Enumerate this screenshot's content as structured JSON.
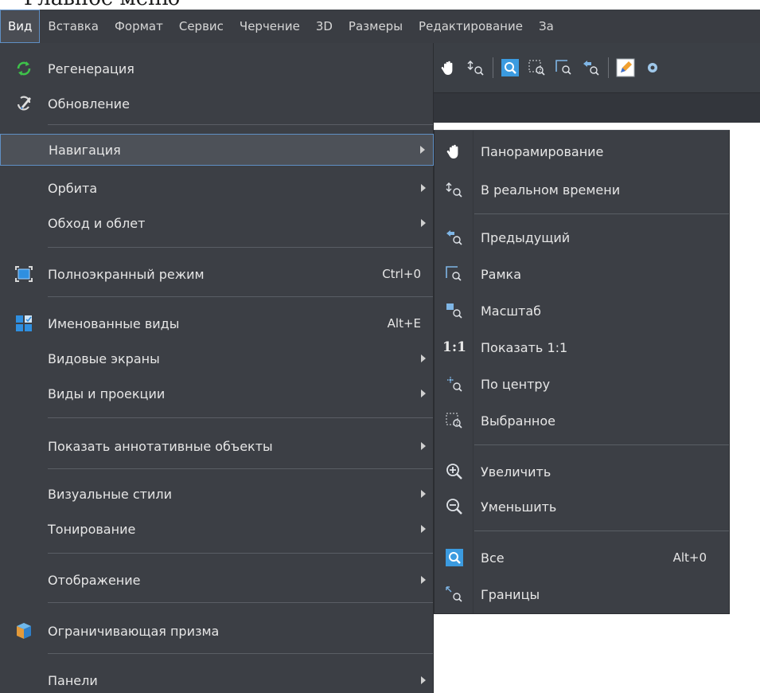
{
  "top_text": "Главное меню",
  "menubar": {
    "items": [
      {
        "label": "Вид",
        "active": true
      },
      {
        "label": "Вставка"
      },
      {
        "label": "Формат"
      },
      {
        "label": "Сервис"
      },
      {
        "label": "Черчение"
      },
      {
        "label": "3D"
      },
      {
        "label": "Размеры"
      },
      {
        "label": "Редактирование"
      },
      {
        "label": "За"
      }
    ]
  },
  "view_menu": {
    "items": [
      {
        "label": "Регенерация",
        "icon": "regen-icon"
      },
      {
        "label": "Обновление",
        "icon": "update-icon"
      },
      {
        "label": "Навигация",
        "submenu": true,
        "highlighted": true
      },
      {
        "label": "Орбита",
        "submenu": true
      },
      {
        "label": "Обход и облет",
        "submenu": true
      },
      {
        "label": "Полноэкранный режим",
        "shortcut": "Ctrl+0",
        "icon": "fullscreen-icon"
      },
      {
        "label": "Именованные виды",
        "shortcut": "Alt+E",
        "icon": "named-views-icon"
      },
      {
        "label": "Видовые экраны",
        "submenu": true
      },
      {
        "label": "Виды и проекции",
        "submenu": true
      },
      {
        "label": "Показать аннотативные объекты",
        "submenu": true
      },
      {
        "label": "Визуальные стили",
        "submenu": true
      },
      {
        "label": "Тонирование",
        "submenu": true
      },
      {
        "label": "Отображение",
        "submenu": true
      },
      {
        "label": "Ограничивающая призма",
        "icon": "bounding-prism-icon"
      },
      {
        "label": "Панели",
        "submenu": true
      }
    ]
  },
  "navigation_submenu": {
    "items": [
      {
        "label": "Панорамирование",
        "icon": "pan-hand-icon"
      },
      {
        "label": "В реальном времени",
        "icon": "realtime-zoom-icon"
      },
      {
        "label": "Предыдущий",
        "icon": "zoom-previous-icon"
      },
      {
        "label": "Рамка",
        "icon": "zoom-window-icon"
      },
      {
        "label": "Масштаб",
        "icon": "zoom-scale-icon"
      },
      {
        "label": "Показать 1:1",
        "icon": "one-to-one-icon",
        "icon_text": "1:1"
      },
      {
        "label": "По центру",
        "icon": "zoom-center-icon"
      },
      {
        "label": "Выбранное",
        "icon": "zoom-selected-icon"
      },
      {
        "label": "Увеличить",
        "icon": "zoom-in-icon"
      },
      {
        "label": "Уменьшить",
        "icon": "zoom-out-icon"
      },
      {
        "label": "Все",
        "shortcut": "Alt+0",
        "icon": "zoom-all-icon"
      },
      {
        "label": "Границы",
        "icon": "zoom-extents-icon"
      }
    ]
  },
  "colors": {
    "menu_bg": "#3c3f45",
    "highlight_border": "#5f8fc4",
    "text": "#e6e6e6",
    "accent_blue": "#3b9be0"
  }
}
